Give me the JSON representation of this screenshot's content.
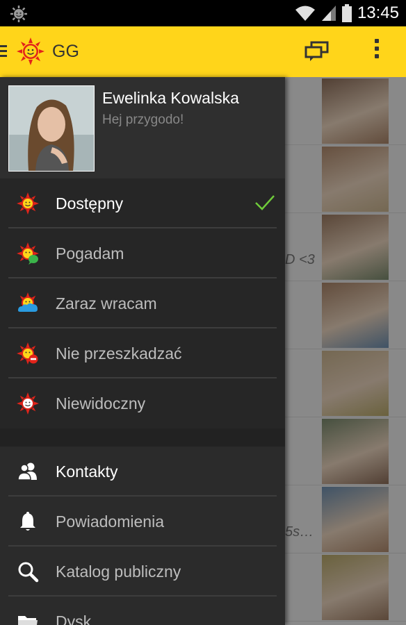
{
  "status_bar": {
    "time": "13:45",
    "icons": [
      "gg-notification-icon",
      "wifi-icon",
      "signal-icon",
      "battery-icon"
    ]
  },
  "app_bar": {
    "title": "GG",
    "icons": [
      "hamburger-icon",
      "gg-sun-logo",
      "conversations-icon",
      "overflow-menu-icon"
    ],
    "color": "#FFD51A"
  },
  "profile": {
    "name": "Ewelinka Kowalska",
    "status_message": "Hej przygodo!"
  },
  "status_options": [
    {
      "label": "Dostępny",
      "icon": "status-available-icon",
      "selected": true
    },
    {
      "label": "Pogadam",
      "icon": "status-chat-icon",
      "selected": false
    },
    {
      "label": "Zaraz wracam",
      "icon": "status-away-icon",
      "selected": false
    },
    {
      "label": "Nie przeszkadzać",
      "icon": "status-dnd-icon",
      "selected": false
    },
    {
      "label": "Niewidoczny",
      "icon": "status-invisible-icon",
      "selected": false
    }
  ],
  "nav_items": [
    {
      "label": "Kontakty",
      "icon": "contacts-icon",
      "active": true
    },
    {
      "label": "Powiadomienia",
      "icon": "bell-icon",
      "active": false
    },
    {
      "label": "Katalog publiczny",
      "icon": "search-icon",
      "active": false
    },
    {
      "label": "Dysk",
      "icon": "folder-icon",
      "active": false
    }
  ],
  "background_contacts": [
    {
      "snippet": ""
    },
    {
      "snippet": ""
    },
    {
      "snippet": "D <3"
    },
    {
      "snippet": ""
    },
    {
      "snippet": ""
    },
    {
      "snippet": ""
    },
    {
      "snippet": "5s…"
    },
    {
      "snippet": ""
    }
  ],
  "colors": {
    "accent_yellow": "#FFD51A",
    "check_green": "#6FCB3A",
    "drawer_bg": "#2b2b2b"
  }
}
